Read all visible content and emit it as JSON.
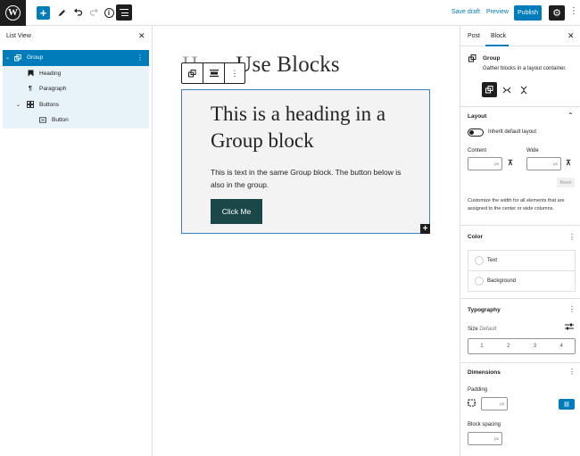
{
  "topbar": {
    "save_draft": "Save draft",
    "preview": "Preview",
    "publish": "Publish"
  },
  "list_view": {
    "title": "List View",
    "items": [
      {
        "label": "Group",
        "icon": "group-icon"
      },
      {
        "label": "Heading",
        "icon": "bookmark-icon"
      },
      {
        "label": "Paragraph",
        "icon": "pilcrow-icon"
      },
      {
        "label": "Buttons",
        "icon": "buttons-icon"
      },
      {
        "label": "Button",
        "icon": "button-icon"
      }
    ]
  },
  "canvas": {
    "post_title_hidden": "H",
    "post_title_visible": "Use Blocks",
    "heading": "This is a heading in a Group block",
    "paragraph": "This is text in the same Group block. The button below is also in the group.",
    "button": "Click Me"
  },
  "sidebar": {
    "tabs": {
      "post": "Post",
      "block": "Block"
    },
    "block_card": {
      "name": "Group",
      "description": "Gather blocks in a layout container."
    },
    "layout": {
      "title": "Layout",
      "toggle_label": "Inherit default layout",
      "content_label": "Content",
      "wide_label": "Wide",
      "unit": "px",
      "reset": "Reset",
      "help": "Customize the width for all elements that are assigned to the center or wide columns."
    },
    "color": {
      "title": "Color",
      "text": "Text",
      "background": "Background"
    },
    "typography": {
      "title": "Typography",
      "size_label": "Size",
      "size_value": "Default",
      "sizes": [
        "1",
        "2",
        "3",
        "4"
      ]
    },
    "dimensions": {
      "title": "Dimensions",
      "padding_label": "Padding",
      "block_spacing_label": "Block spacing",
      "unit": "px"
    }
  },
  "colors": {
    "accent": "#007cba",
    "button_bg": "#1a4848",
    "dark": "#1e1e1e"
  }
}
